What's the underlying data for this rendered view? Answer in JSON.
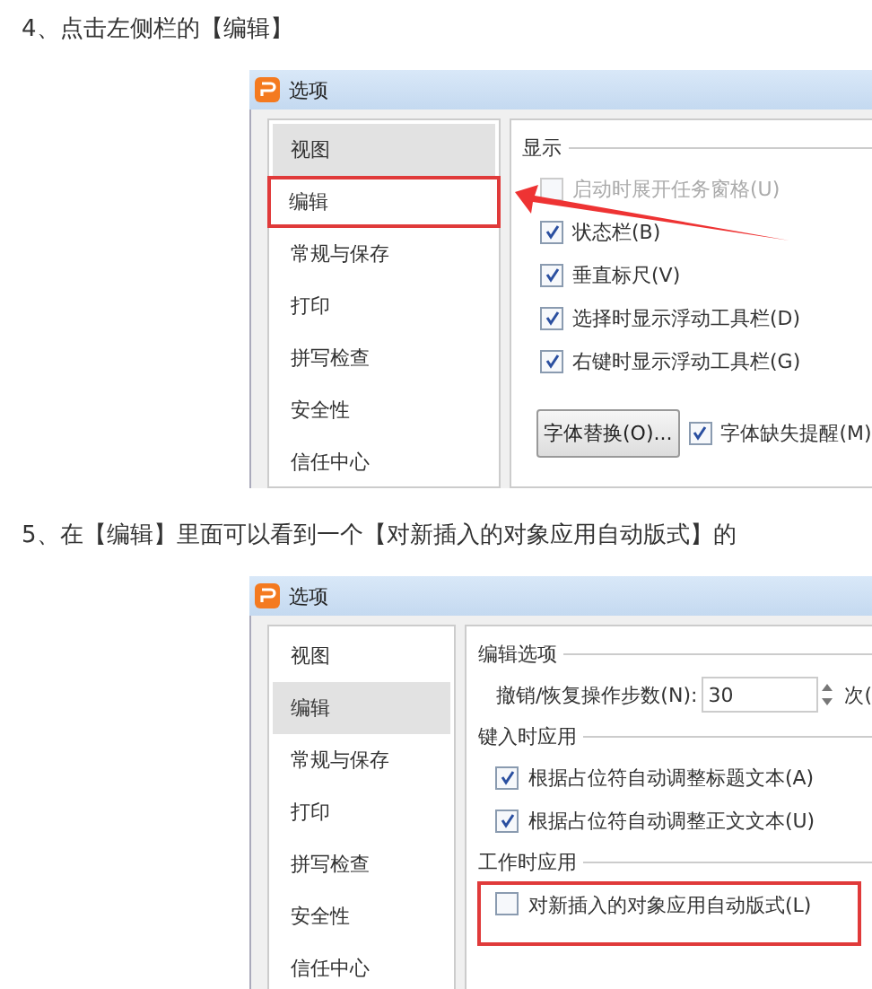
{
  "steps": [
    {
      "text": "4、点击左侧栏的【编辑】",
      "dialog": {
        "title": "选项",
        "arrow": true,
        "sidebar": [
          {
            "label": "视图",
            "selected": true,
            "highlighted": false
          },
          {
            "label": "编辑",
            "selected": false,
            "highlighted": true
          },
          {
            "label": "常规与保存",
            "selected": false,
            "highlighted": false
          },
          {
            "label": "打印",
            "selected": false,
            "highlighted": false
          },
          {
            "label": "拼写检查",
            "selected": false,
            "highlighted": false
          },
          {
            "label": "安全性",
            "selected": false,
            "highlighted": false
          },
          {
            "label": "信任中心",
            "selected": false,
            "highlighted": false
          }
        ],
        "groups": [
          {
            "title": "显示",
            "items": [
              {
                "kind": "checkbox",
                "label": "启动时展开任务窗格(U)",
                "checked": false,
                "disabled": true,
                "highlighted": false
              },
              {
                "kind": "checkbox",
                "label": "状态栏(B)",
                "checked": true,
                "disabled": false,
                "highlighted": false
              },
              {
                "kind": "checkbox",
                "label": "垂直标尺(V)",
                "checked": true,
                "disabled": false,
                "highlighted": false
              },
              {
                "kind": "checkbox",
                "label": "选择时显示浮动工具栏(D)",
                "checked": true,
                "disabled": false,
                "highlighted": false
              },
              {
                "kind": "checkbox",
                "label": "右键时显示浮动工具栏(G)",
                "checked": true,
                "disabled": false,
                "highlighted": false
              },
              {
                "kind": "button-check",
                "button": "字体替换(O)...",
                "label": "字体缺失提醒(M)",
                "checked": true
              }
            ]
          }
        ]
      }
    },
    {
      "text": "5、在【编辑】里面可以看到一个【对新插入的对象应用自动版式】的",
      "dialog": {
        "title": "选项",
        "arrow": false,
        "sidebar": [
          {
            "label": "视图",
            "selected": false,
            "highlighted": false
          },
          {
            "label": "编辑",
            "selected": true,
            "highlighted": false
          },
          {
            "label": "常规与保存",
            "selected": false,
            "highlighted": false
          },
          {
            "label": "打印",
            "selected": false,
            "highlighted": false
          },
          {
            "label": "拼写检查",
            "selected": false,
            "highlighted": false
          },
          {
            "label": "安全性",
            "selected": false,
            "highlighted": false
          },
          {
            "label": "信任中心",
            "selected": false,
            "highlighted": false
          }
        ],
        "groups": [
          {
            "title": "编辑选项",
            "items": [
              {
                "kind": "spinner",
                "label": "撤销/恢复操作步数(N):",
                "value": "30",
                "suffix": "次("
              }
            ]
          },
          {
            "title": "键入时应用",
            "items": [
              {
                "kind": "checkbox",
                "label": "根据占位符自动调整标题文本(A)",
                "checked": true,
                "disabled": false,
                "highlighted": false
              },
              {
                "kind": "checkbox",
                "label": "根据占位符自动调整正文文本(U)",
                "checked": true,
                "disabled": false,
                "highlighted": false
              }
            ]
          },
          {
            "title": "工作时应用",
            "items": [
              {
                "kind": "checkbox",
                "label": "对新插入的对象应用自动版式(L)",
                "checked": false,
                "disabled": false,
                "highlighted": true
              }
            ]
          }
        ]
      }
    }
  ]
}
